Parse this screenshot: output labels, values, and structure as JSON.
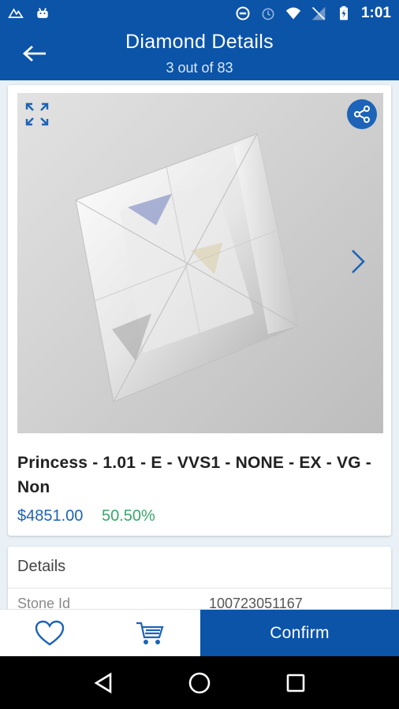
{
  "status_bar": {
    "time": "1:01",
    "icons_left": [
      "app-logo-icon",
      "android-icon"
    ],
    "icons_right": [
      "data-saver-icon",
      "alarm-icon",
      "wifi-icon",
      "no-signal-icon",
      "battery-charging-icon"
    ]
  },
  "header": {
    "title": "Diamond Details",
    "subtitle": "3 out of 83",
    "back_icon": "back-arrow-icon"
  },
  "product": {
    "title": "Princess - 1.01 - E - VVS1 - NONE - EX - VG - Non",
    "price": "$4851.00",
    "discount": "50.50%",
    "image_icons": [
      "expand-icon",
      "share-icon",
      "chevron-right-icon"
    ]
  },
  "details": {
    "heading": "Details",
    "rows": [
      {
        "label": "Stone Id",
        "value": "100723051167"
      }
    ]
  },
  "actions": {
    "favorite_icon": "heart-icon",
    "cart_icon": "cart-icon",
    "confirm_label": "Confirm"
  },
  "colors": {
    "primary": "#0b54a8",
    "price": "#1d63b7",
    "discount": "#3aa56a"
  },
  "nav_bar": {
    "icons": [
      "back-triangle-icon",
      "home-circle-icon",
      "recents-square-icon"
    ]
  }
}
